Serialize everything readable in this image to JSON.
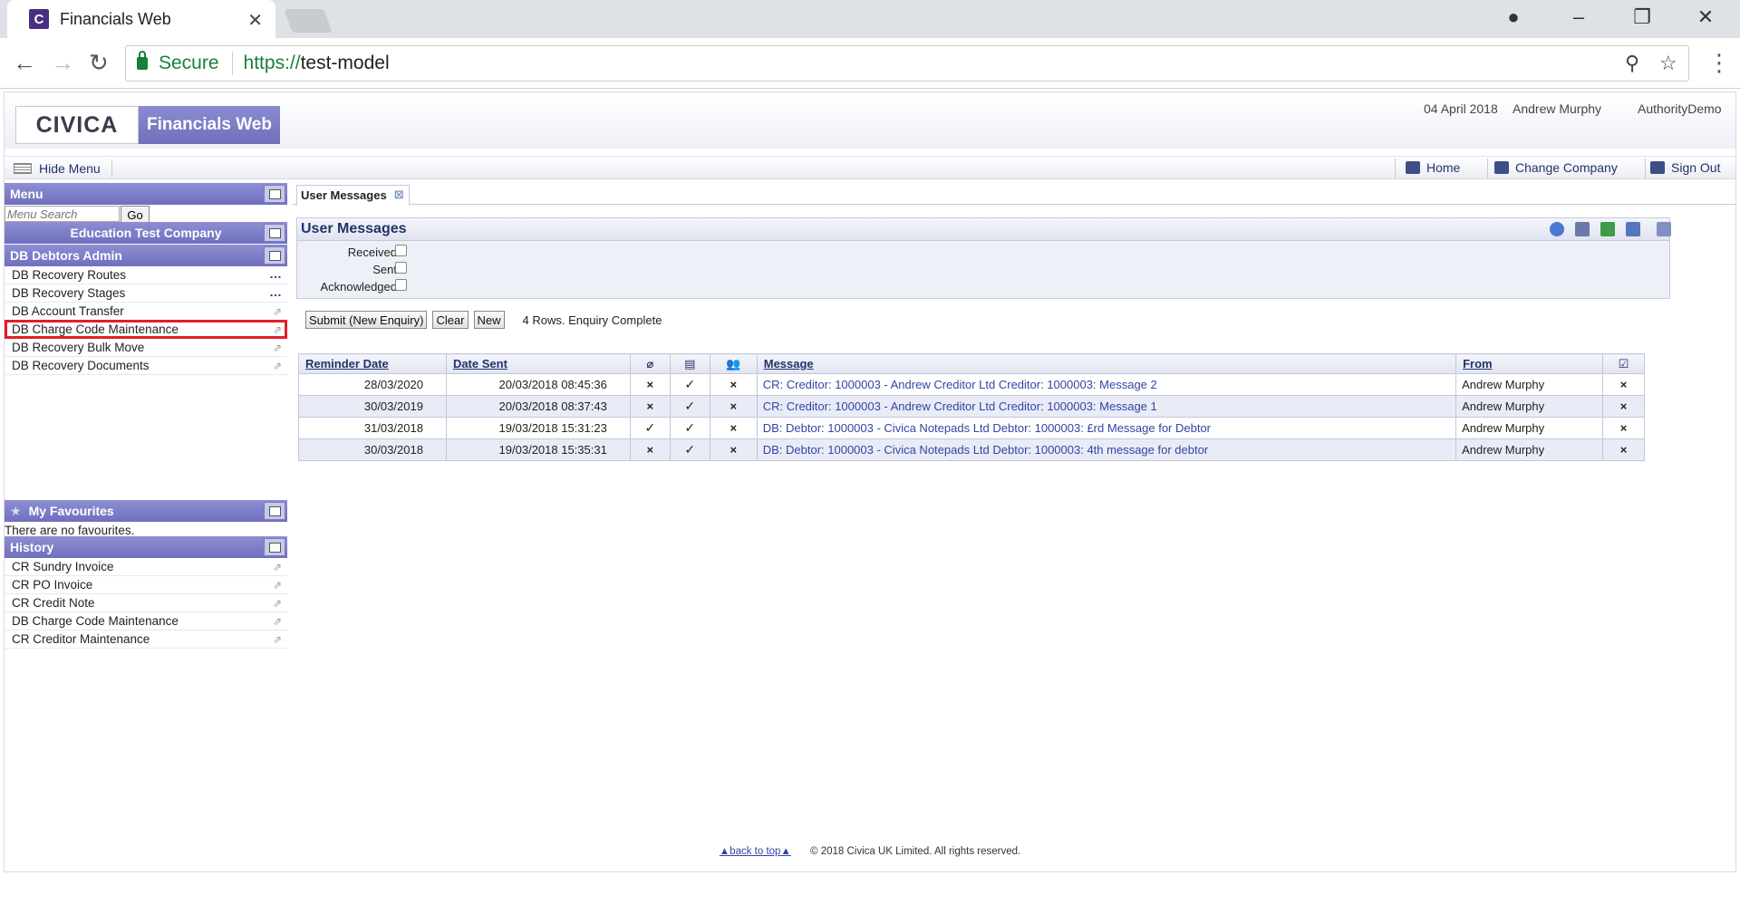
{
  "browser": {
    "tab_title": "Financials Web",
    "favicon_letter": "C",
    "secure_label": "Secure",
    "url_scheme": "https://",
    "url_host": "test-model"
  },
  "header": {
    "logo_text": "CIVICA",
    "product_name": "Financials Web",
    "date": "04 April 2018",
    "user": "Andrew Murphy",
    "authority": "AuthorityDemo"
  },
  "toolbar": {
    "hide_menu": "Hide Menu",
    "home": "Home",
    "change_company": "Change Company",
    "sign_out": "Sign Out"
  },
  "sidebar": {
    "menu_title": "Menu",
    "search_placeholder": "Menu Search",
    "go_label": "Go",
    "company": "Education Test Company",
    "group_title": "DB Debtors Admin",
    "items": [
      {
        "label": "DB Recovery Routes"
      },
      {
        "label": "DB Recovery Stages"
      },
      {
        "label": "DB Account Transfer"
      },
      {
        "label": "DB Charge Code Maintenance"
      },
      {
        "label": "DB Recovery Bulk Move"
      },
      {
        "label": "DB Recovery Documents"
      }
    ],
    "favourites_title": "My Favourites",
    "favourites_empty": "There are no favourites.",
    "history_title": "History",
    "history": [
      {
        "label": "CR Sundry Invoice"
      },
      {
        "label": "CR PO Invoice"
      },
      {
        "label": "CR Credit Note"
      },
      {
        "label": "DB Charge Code Maintenance"
      },
      {
        "label": "CR Creditor Maintenance"
      }
    ]
  },
  "main": {
    "tab_label": "User Messages",
    "section_title": "User Messages",
    "filters": {
      "received": "Received",
      "sent": "Sent",
      "acknowledged": "Acknowledged"
    },
    "buttons": {
      "submit": "Submit (New Enquiry)",
      "clear": "Clear",
      "new": "New"
    },
    "status": "4 Rows. Enquiry Complete",
    "columns": {
      "reminder_date": "Reminder Date",
      "date_sent": "Date Sent",
      "message": "Message",
      "from": "From"
    },
    "rows": [
      {
        "reminder": "28/03/2020",
        "sent": "20/03/2018 08:45:36",
        "attach": "×",
        "read": "✓",
        "group": "×",
        "message": "CR: Creditor: 1000003 - Andrew Creditor Ltd Creditor: 1000003: Message 2",
        "from": "Andrew Murphy",
        "ack": "×"
      },
      {
        "reminder": "30/03/2019",
        "sent": "20/03/2018 08:37:43",
        "attach": "×",
        "read": "✓",
        "group": "×",
        "message": "CR: Creditor: 1000003 - Andrew Creditor Ltd Creditor: 1000003: Message 1",
        "from": "Andrew Murphy",
        "ack": "×"
      },
      {
        "reminder": "31/03/2018",
        "sent": "19/03/2018 15:31:23",
        "attach": "✓",
        "read": "✓",
        "group": "×",
        "message": "DB: Debtor: 1000003 - Civica Notepads Ltd Debtor: 1000003: £rd Message for Debtor",
        "from": "Andrew Murphy",
        "ack": "×"
      },
      {
        "reminder": "30/03/2018",
        "sent": "19/03/2018 15:35:31",
        "attach": "×",
        "read": "✓",
        "group": "×",
        "message": "DB: Debtor: 1000003 - Civica Notepads Ltd Debtor: 1000003: 4th message for debtor",
        "from": "Andrew Murphy",
        "ack": "×"
      }
    ]
  },
  "footer": {
    "back_to_top": "back to top",
    "copyright": "© 2018 Civica UK Limited. All rights reserved."
  }
}
